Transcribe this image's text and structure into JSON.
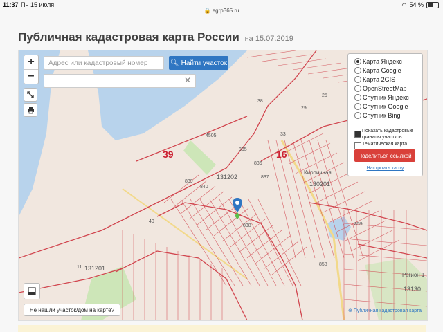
{
  "status_bar": {
    "time": "11:37",
    "date": "Пн 15 июля",
    "url": "egrp365.ru",
    "battery": "54 %",
    "battery_level_percent": 54
  },
  "page": {
    "title": "Публичная кадастровая карта России",
    "date_prefix": "на",
    "date": "15.07.2019"
  },
  "map": {
    "zoom_in": "+",
    "zoom_out": "−",
    "search_placeholder": "Адрес или кадастровый номер участка",
    "find_button": "Найти участок",
    "not_found_button": "Не нашли участок/дом на карте?",
    "attribution": "Публичная кадастровая карта",
    "labels": {
      "quarter_main": "131202",
      "quarter_left": "131201",
      "quarter_right": "130201",
      "quarter_br": "13130",
      "big_39": "39",
      "big_16": "16",
      "n4505": "4505",
      "n835": "835",
      "n836": "836",
      "n837": "837",
      "n838": "838",
      "n839": "839",
      "n840": "840",
      "n859": "859",
      "n858": "858",
      "n40": "40",
      "n11": "11",
      "n33": "33",
      "n38": "38",
      "n29": "29",
      "n25": "25",
      "kirpichnaya": "Кирпичная",
      "region": "Регион 1"
    }
  },
  "layers_panel": {
    "options": [
      {
        "label": "Карта Яндекс",
        "selected": true
      },
      {
        "label": "Карта Google",
        "selected": false
      },
      {
        "label": "Карта 2GIS",
        "selected": false
      },
      {
        "label": "OpenStreetMap",
        "selected": false
      },
      {
        "label": "Спутник Яндекс",
        "selected": false
      },
      {
        "label": "Спутник Google",
        "selected": false
      },
      {
        "label": "Спутник Bing",
        "selected": false
      }
    ],
    "show_boundaries": "Показать кадастровые границы участков",
    "show_boundaries_checked": true,
    "thematic": "Тематическая карта",
    "thematic_checked": false,
    "share_button": "Поделиться ссылкой",
    "setup_link": "Настроить карту"
  },
  "colors": {
    "accent_blue": "#2f76c2",
    "share_red": "#d9403a",
    "water": "#b8d3ec",
    "land": "#f1e7df",
    "boundary": "#d1454e",
    "green": "#cde6b8"
  }
}
